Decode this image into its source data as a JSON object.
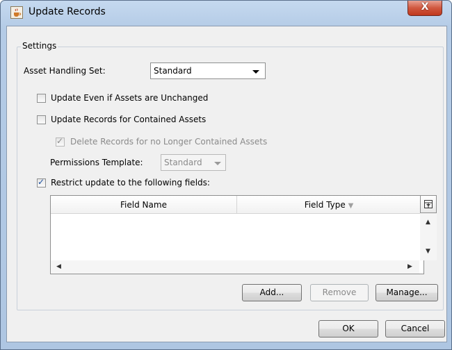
{
  "window": {
    "title": "Update Records",
    "close_glyph": "X"
  },
  "settings": {
    "group_label": "Settings",
    "asset_handling_label": "Asset Handling Set:",
    "asset_handling_value": "Standard",
    "update_unchanged_label": "Update Even if Assets are Unchanged",
    "update_unchanged_checked": false,
    "update_contained_label": "Update Records for Contained Assets",
    "update_contained_checked": false,
    "delete_records_label": "Delete Records for no Longer Contained Assets",
    "delete_records_checked": true,
    "delete_records_enabled": false,
    "permissions_label": "Permissions Template:",
    "permissions_value": "Standard",
    "restrict_label": "Restrict update to the following fields:",
    "restrict_checked": true
  },
  "fields_table": {
    "columns": [
      "Field Name",
      "Field Type"
    ],
    "rows": []
  },
  "buttons": {
    "add": "Add...",
    "remove": "Remove",
    "manage": "Manage...",
    "ok": "OK",
    "cancel": "Cancel"
  },
  "icons": {
    "app": "java-cup-icon",
    "sort": "sort-descending-icon",
    "column_chooser": "column-chooser-icon"
  }
}
